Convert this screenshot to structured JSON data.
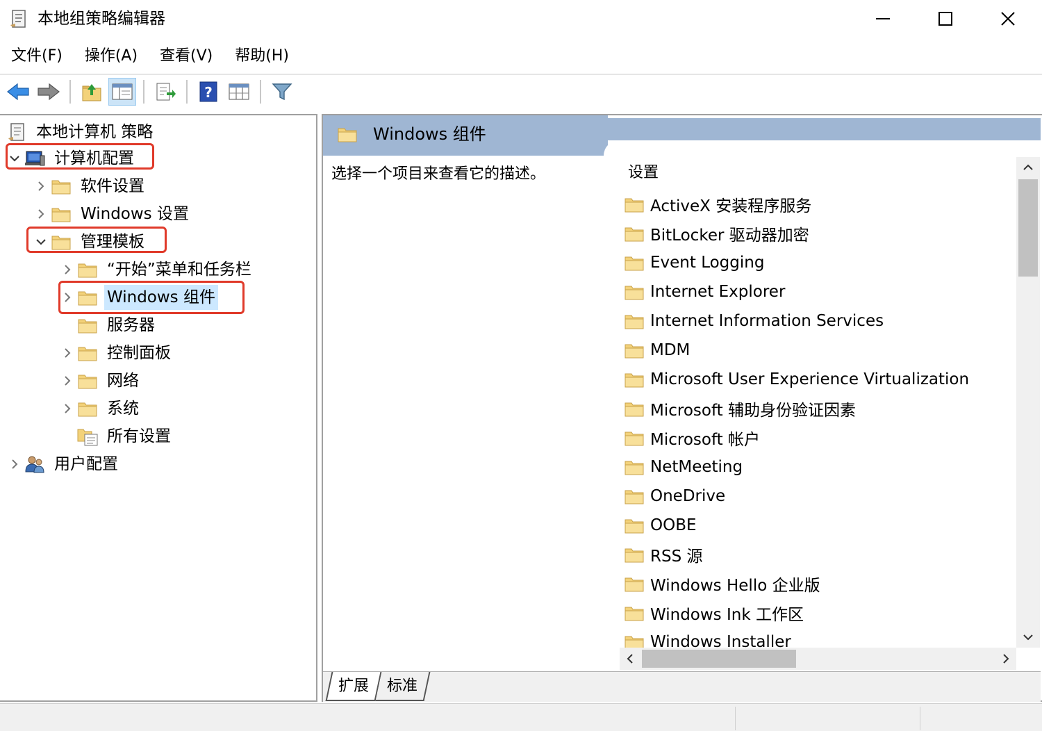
{
  "window": {
    "title": "本地组策略编辑器"
  },
  "menu": {
    "items": [
      "文件(F)",
      "操作(A)",
      "查看(V)",
      "帮助(H)"
    ]
  },
  "tree": {
    "root": "本地计算机 策略",
    "computer_config": "计算机配置",
    "software_settings": "软件设置",
    "windows_settings": "Windows 设置",
    "admin_templates": "管理模板",
    "start_menu": "“开始”菜单和任务栏",
    "windows_components": "Windows 组件",
    "server": "服务器",
    "control_panel": "控制面板",
    "network": "网络",
    "system": "系统",
    "all_settings": "所有设置",
    "user_config": "用户配置"
  },
  "details": {
    "header_title": "Windows 组件",
    "description": "选择一个项目来查看它的描述。",
    "column_header": "设置",
    "items": [
      "ActiveX 安装程序服务",
      "BitLocker 驱动器加密",
      "Event Logging",
      "Internet Explorer",
      "Internet Information Services",
      "MDM",
      "Microsoft User Experience Virtualization",
      "Microsoft 辅助身份验证因素",
      "Microsoft 帐户",
      "NetMeeting",
      "OneDrive",
      "OOBE",
      "RSS 源",
      "Windows Hello 企业版",
      "Windows Ink 工作区",
      "Windows Installer"
    ]
  },
  "tabs": {
    "extended": "扩展",
    "standard": "标准"
  },
  "colors": {
    "highlight_box": "#e03a2a",
    "header_bar": "#9fb6d3",
    "folder_yellow": "#f3d27a"
  }
}
